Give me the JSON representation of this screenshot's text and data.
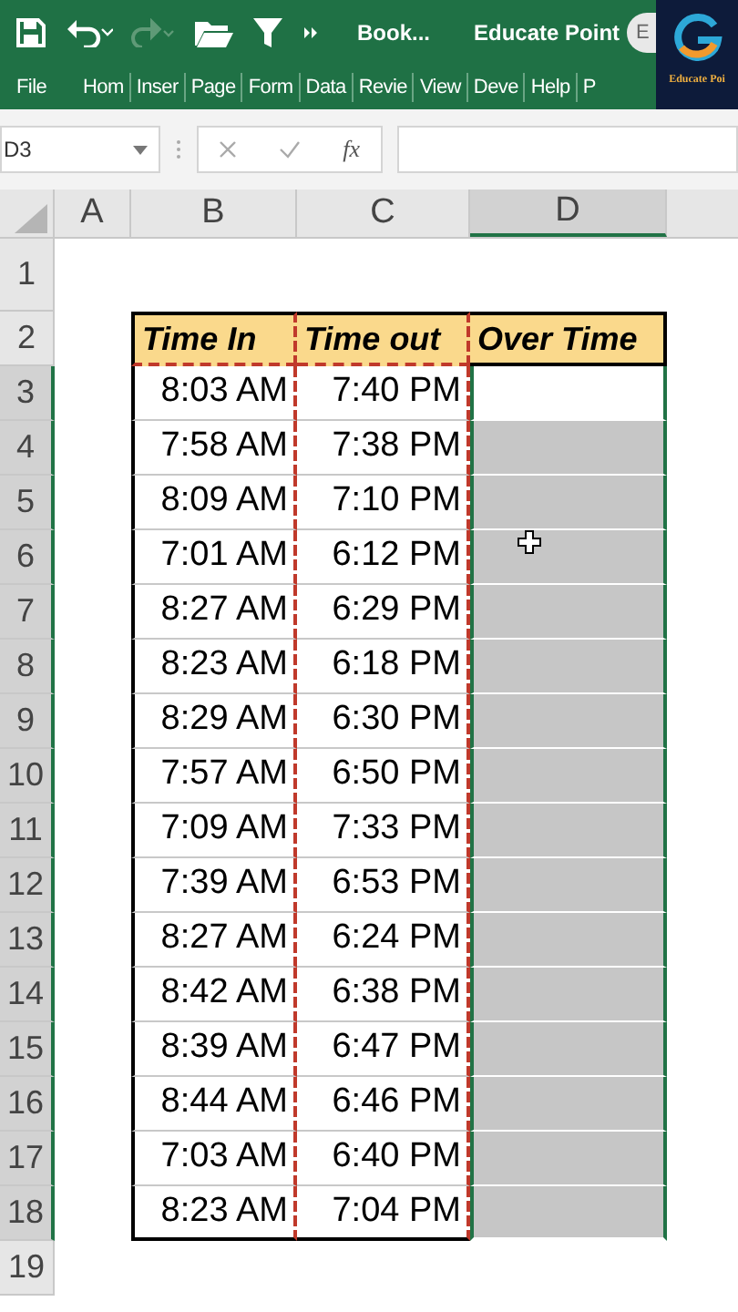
{
  "title_bar": {
    "document": "Book...",
    "account": "Educate Point",
    "avatar": "E",
    "redo_enabled": false
  },
  "logo": {
    "caption": "Educate Poi"
  },
  "ribbon_tabs": [
    {
      "label": "File",
      "selected": false
    },
    {
      "label": "Hom",
      "selected": false
    },
    {
      "label": "Inser",
      "selected": false
    },
    {
      "label": "Page",
      "selected": false
    },
    {
      "label": "Form",
      "selected": false
    },
    {
      "label": "Data",
      "selected": false
    },
    {
      "label": "Revie",
      "selected": false
    },
    {
      "label": "View",
      "selected": false
    },
    {
      "label": "Deve",
      "selected": false
    },
    {
      "label": "Help",
      "selected": false
    },
    {
      "label": "P",
      "selected": false
    }
  ],
  "formula_bar": {
    "name_box": "D3",
    "function_label": "fx"
  },
  "columns": [
    {
      "label": "A",
      "selected": false
    },
    {
      "label": "B",
      "selected": false
    },
    {
      "label": "C",
      "selected": false
    },
    {
      "label": "D",
      "selected": true
    }
  ],
  "row_headers": [
    {
      "label": "1",
      "selected": false
    },
    {
      "label": "2",
      "selected": false
    },
    {
      "label": "3",
      "selected": true
    },
    {
      "label": "4",
      "selected": true
    },
    {
      "label": "5",
      "selected": true
    },
    {
      "label": "6",
      "selected": true
    },
    {
      "label": "7",
      "selected": true
    },
    {
      "label": "8",
      "selected": true
    },
    {
      "label": "9",
      "selected": true
    },
    {
      "label": "10",
      "selected": true
    },
    {
      "label": "11",
      "selected": true
    },
    {
      "label": "12",
      "selected": true
    },
    {
      "label": "13",
      "selected": true
    },
    {
      "label": "14",
      "selected": true
    },
    {
      "label": "15",
      "selected": true
    },
    {
      "label": "16",
      "selected": true
    },
    {
      "label": "17",
      "selected": true
    },
    {
      "label": "18",
      "selected": true
    },
    {
      "label": "19",
      "selected": false
    }
  ],
  "table": {
    "headers": [
      "Time In",
      "Time out",
      "Over Time"
    ],
    "rows": [
      {
        "time_in": "8:03 AM",
        "time_out": "7:40 PM",
        "selected": true,
        "active": true
      },
      {
        "time_in": "7:58 AM",
        "time_out": "7:38 PM",
        "selected": true,
        "active": false
      },
      {
        "time_in": "8:09 AM",
        "time_out": "7:10 PM",
        "selected": true,
        "active": false
      },
      {
        "time_in": "7:01 AM",
        "time_out": "6:12 PM",
        "selected": true,
        "active": false
      },
      {
        "time_in": "8:27 AM",
        "time_out": "6:29 PM",
        "selected": true,
        "active": false
      },
      {
        "time_in": "8:23 AM",
        "time_out": "6:18 PM",
        "selected": true,
        "active": false
      },
      {
        "time_in": "8:29 AM",
        "time_out": "6:30 PM",
        "selected": true,
        "active": false
      },
      {
        "time_in": "7:57 AM",
        "time_out": "6:50 PM",
        "selected": true,
        "active": false
      },
      {
        "time_in": "7:09 AM",
        "time_out": "7:33 PM",
        "selected": true,
        "active": false
      },
      {
        "time_in": "7:39 AM",
        "time_out": "6:53 PM",
        "selected": true,
        "active": false
      },
      {
        "time_in": "8:27 AM",
        "time_out": "6:24 PM",
        "selected": true,
        "active": false
      },
      {
        "time_in": "8:42 AM",
        "time_out": "6:38 PM",
        "selected": true,
        "active": false
      },
      {
        "time_in": "8:39 AM",
        "time_out": "6:47 PM",
        "selected": true,
        "active": false
      },
      {
        "time_in": "8:44 AM",
        "time_out": "6:46 PM",
        "selected": true,
        "active": false
      },
      {
        "time_in": "7:03 AM",
        "time_out": "6:40 PM",
        "selected": true,
        "active": false
      },
      {
        "time_in": "8:23 AM",
        "time_out": "7:04 PM",
        "selected": true,
        "active": false
      }
    ]
  }
}
